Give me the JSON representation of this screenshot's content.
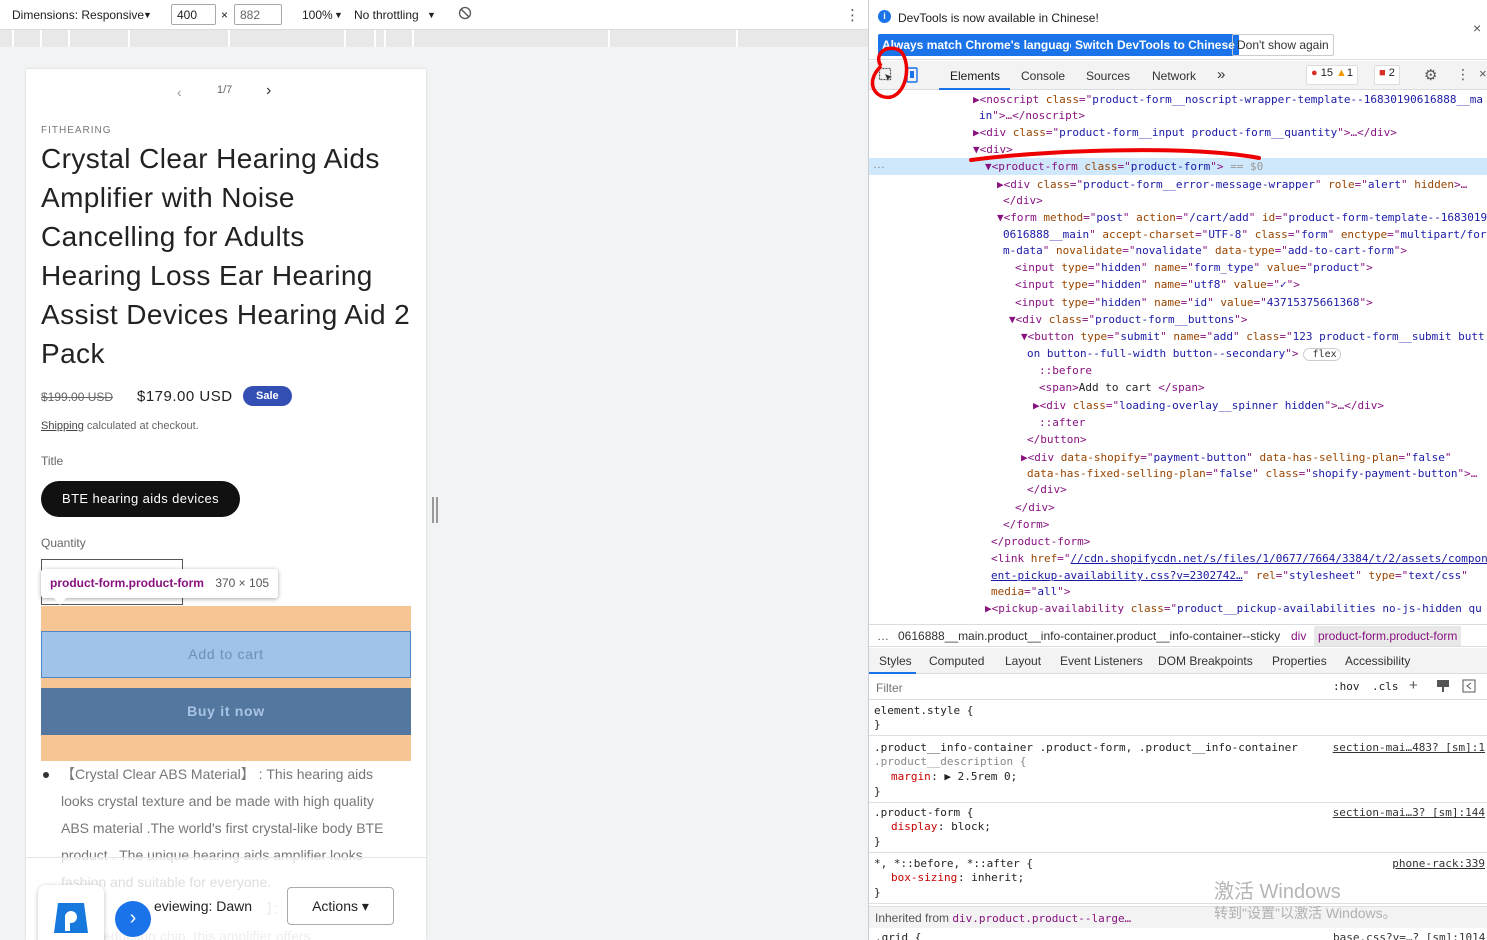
{
  "devbar": {
    "dimensions": "Dimensions: Responsive",
    "width": "400",
    "height": "882",
    "times": "×",
    "zoom": "100%",
    "throttling": "No throttling",
    "more": "⋮"
  },
  "product": {
    "vendor": "FITHEARING",
    "pager": "1/7",
    "title_lines": [
      "Crystal Clear Hearing Aids",
      "Amplifier with Noise",
      "Cancelling for Adults",
      "Hearing Loss Ear Hearing",
      "Assist Devices Hearing Aid 2",
      "Pack"
    ],
    "old_price": "$199.00 USD",
    "price": "$179.00 USD",
    "sale": "Sale",
    "shipping_link": "Shipping",
    "shipping_text": " calculated at checkout.",
    "title_label": "Title",
    "variant": "BTE hearing aids devices",
    "quantity_label": "Quantity",
    "tooltip_name": "product-form.product-form",
    "tooltip_size": "370 × 105",
    "add_to_cart": "Add to cart",
    "buy_now": "Buy it now",
    "desc_lines": [
      "【Crystal Clear ABS Material】 : This hearing aids",
      "looks crystal texture and be made with high quality",
      "ABS material .The world's first crystal-like body BTE",
      "product . The unique hearing aids amplifier looks",
      "fashion and suitable for everyone.",
      "】：Hearing",
      "noise reduction chip, this amplifier offers"
    ],
    "preview_text": "eviewing: Dawn",
    "actions": "Actions ▾"
  },
  "devtools": {
    "infobar": "DevTools is now available in Chinese!",
    "btn_match": "Always match Chrome's language",
    "btn_switch": "Switch DevTools to Chinese",
    "btn_dont": "Don't show again",
    "tabs": [
      "Elements",
      "Console",
      "Sources",
      "Network"
    ],
    "more_tabs": "»",
    "err_count": "15",
    "warn_count": "1",
    "issue_count": "2",
    "close": "×",
    "dom_lines": [
      [
        {
          "c": "tok-tag",
          "t": "▶<noscript "
        },
        {
          "c": "tok-attr",
          "t": "class"
        },
        {
          "c": "tok-tag",
          "t": "=\""
        },
        {
          "c": "tok-val",
          "t": "product-form__noscript-wrapper-template--16830190616888__ma"
        }
      ],
      [
        {
          "c": "tok-val",
          "t": "in"
        },
        {
          "c": "tok-tag",
          "t": "\">…</noscript>"
        }
      ],
      [
        {
          "c": "tok-tag",
          "t": "▶<div "
        },
        {
          "c": "tok-attr",
          "t": "class"
        },
        {
          "c": "tok-tag",
          "t": "=\""
        },
        {
          "c": "tok-val",
          "t": "product-form__input product-form__quantity"
        },
        {
          "c": "tok-tag",
          "t": "\">…</div>"
        }
      ],
      [
        {
          "c": "tok-tag",
          "t": "▼<div>"
        }
      ],
      [
        {
          "c": "tok-tag",
          "t": "▼<product-form "
        },
        {
          "c": "tok-attr",
          "t": "class"
        },
        {
          "c": "tok-tag",
          "t": "=\""
        },
        {
          "c": "tok-val",
          "t": "product-form"
        },
        {
          "c": "tok-tag",
          "t": "\">"
        },
        {
          "c": "tok-cm",
          "t": " == $0"
        }
      ],
      [
        {
          "c": "tok-tag",
          "t": "▶<div "
        },
        {
          "c": "tok-attr",
          "t": "class"
        },
        {
          "c": "tok-tag",
          "t": "=\""
        },
        {
          "c": "tok-val",
          "t": "product-form__error-message-wrapper"
        },
        {
          "c": "tok-tag",
          "t": "\" "
        },
        {
          "c": "tok-attr",
          "t": "role"
        },
        {
          "c": "tok-tag",
          "t": "=\""
        },
        {
          "c": "tok-val",
          "t": "alert"
        },
        {
          "c": "tok-tag",
          "t": "\" "
        },
        {
          "c": "tok-attr",
          "t": "hidden"
        },
        {
          "c": "tok-tag",
          "t": ">…"
        }
      ],
      [
        {
          "c": "tok-tag",
          "t": "</div>"
        }
      ],
      [
        {
          "c": "tok-tag",
          "t": "▼<form "
        },
        {
          "c": "tok-attr",
          "t": "method"
        },
        {
          "c": "tok-tag",
          "t": "=\""
        },
        {
          "c": "tok-val",
          "t": "post"
        },
        {
          "c": "tok-tag",
          "t": "\" "
        },
        {
          "c": "tok-attr",
          "t": "action"
        },
        {
          "c": "tok-tag",
          "t": "=\""
        },
        {
          "c": "tok-val",
          "t": "/cart/add"
        },
        {
          "c": "tok-tag",
          "t": "\" "
        },
        {
          "c": "tok-attr",
          "t": "id"
        },
        {
          "c": "tok-tag",
          "t": "=\""
        },
        {
          "c": "tok-val",
          "t": "product-form-template--1683019"
        }
      ],
      [
        {
          "c": "tok-val",
          "t": "0616888__main"
        },
        {
          "c": "tok-tag",
          "t": "\" "
        },
        {
          "c": "tok-attr",
          "t": "accept-charset"
        },
        {
          "c": "tok-tag",
          "t": "=\""
        },
        {
          "c": "tok-val",
          "t": "UTF-8"
        },
        {
          "c": "tok-tag",
          "t": "\" "
        },
        {
          "c": "tok-attr",
          "t": "class"
        },
        {
          "c": "tok-tag",
          "t": "=\""
        },
        {
          "c": "tok-val",
          "t": "form"
        },
        {
          "c": "tok-tag",
          "t": "\" "
        },
        {
          "c": "tok-attr",
          "t": "enctype"
        },
        {
          "c": "tok-tag",
          "t": "=\""
        },
        {
          "c": "tok-val",
          "t": "multipart/for"
        }
      ],
      [
        {
          "c": "tok-val",
          "t": "m-data"
        },
        {
          "c": "tok-tag",
          "t": "\" "
        },
        {
          "c": "tok-attr",
          "t": "novalidate"
        },
        {
          "c": "tok-tag",
          "t": "=\""
        },
        {
          "c": "tok-val",
          "t": "novalidate"
        },
        {
          "c": "tok-tag",
          "t": "\" "
        },
        {
          "c": "tok-attr",
          "t": "data-type"
        },
        {
          "c": "tok-tag",
          "t": "=\""
        },
        {
          "c": "tok-val",
          "t": "add-to-cart-form"
        },
        {
          "c": "tok-tag",
          "t": "\">"
        }
      ],
      [
        {
          "c": "tok-tag",
          "t": "<input "
        },
        {
          "c": "tok-attr",
          "t": "type"
        },
        {
          "c": "tok-tag",
          "t": "=\""
        },
        {
          "c": "tok-val",
          "t": "hidden"
        },
        {
          "c": "tok-tag",
          "t": "\" "
        },
        {
          "c": "tok-attr",
          "t": "name"
        },
        {
          "c": "tok-tag",
          "t": "=\""
        },
        {
          "c": "tok-val",
          "t": "form_type"
        },
        {
          "c": "tok-tag",
          "t": "\" "
        },
        {
          "c": "tok-attr",
          "t": "value"
        },
        {
          "c": "tok-tag",
          "t": "=\""
        },
        {
          "c": "tok-val",
          "t": "product"
        },
        {
          "c": "tok-tag",
          "t": "\">"
        }
      ],
      [
        {
          "c": "tok-tag",
          "t": "<input "
        },
        {
          "c": "tok-attr",
          "t": "type"
        },
        {
          "c": "tok-tag",
          "t": "=\""
        },
        {
          "c": "tok-val",
          "t": "hidden"
        },
        {
          "c": "tok-tag",
          "t": "\" "
        },
        {
          "c": "tok-attr",
          "t": "name"
        },
        {
          "c": "tok-tag",
          "t": "=\""
        },
        {
          "c": "tok-val",
          "t": "utf8"
        },
        {
          "c": "tok-tag",
          "t": "\" "
        },
        {
          "c": "tok-attr",
          "t": "value"
        },
        {
          "c": "tok-tag",
          "t": "=\""
        },
        {
          "c": "tok-val",
          "t": "✓"
        },
        {
          "c": "tok-tag",
          "t": "\">"
        }
      ],
      [
        {
          "c": "tok-tag",
          "t": "<input "
        },
        {
          "c": "tok-attr",
          "t": "type"
        },
        {
          "c": "tok-tag",
          "t": "=\""
        },
        {
          "c": "tok-val",
          "t": "hidden"
        },
        {
          "c": "tok-tag",
          "t": "\" "
        },
        {
          "c": "tok-attr",
          "t": "name"
        },
        {
          "c": "tok-tag",
          "t": "=\""
        },
        {
          "c": "tok-val",
          "t": "id"
        },
        {
          "c": "tok-tag",
          "t": "\" "
        },
        {
          "c": "tok-attr",
          "t": "value"
        },
        {
          "c": "tok-tag",
          "t": "=\""
        },
        {
          "c": "tok-val",
          "t": "43715375661368"
        },
        {
          "c": "tok-tag",
          "t": "\">"
        }
      ],
      [
        {
          "c": "tok-tag",
          "t": "▼<div "
        },
        {
          "c": "tok-attr",
          "t": "class"
        },
        {
          "c": "tok-tag",
          "t": "=\""
        },
        {
          "c": "tok-val",
          "t": "product-form__buttons"
        },
        {
          "c": "tok-tag",
          "t": "\">"
        }
      ],
      [
        {
          "c": "tok-tag",
          "t": "▼<button "
        },
        {
          "c": "tok-attr",
          "t": "type"
        },
        {
          "c": "tok-tag",
          "t": "=\""
        },
        {
          "c": "tok-val",
          "t": "submit"
        },
        {
          "c": "tok-tag",
          "t": "\" "
        },
        {
          "c": "tok-attr",
          "t": "name"
        },
        {
          "c": "tok-tag",
          "t": "=\""
        },
        {
          "c": "tok-val",
          "t": "add"
        },
        {
          "c": "tok-tag",
          "t": "\" "
        },
        {
          "c": "tok-attr",
          "t": "class"
        },
        {
          "c": "tok-tag",
          "t": "=\""
        },
        {
          "c": "tok-val",
          "t": "123 product-form__submit butt"
        }
      ],
      [
        {
          "c": "tok-val",
          "t": "on button--full-width button--secondary"
        },
        {
          "c": "tok-tag",
          "t": "\">"
        },
        {
          "c": "tok-cm",
          "t": " flex "
        }
      ],
      [
        {
          "c": "tok-tag",
          "t": "::before"
        }
      ],
      [
        {
          "c": "tok-tag",
          "t": "<span>"
        },
        {
          "c": "tok-txt",
          "t": "Add to cart "
        },
        {
          "c": "tok-tag",
          "t": "</span>"
        }
      ],
      [
        {
          "c": "tok-tag",
          "t": "▶<div "
        },
        {
          "c": "tok-attr",
          "t": "class"
        },
        {
          "c": "tok-tag",
          "t": "=\""
        },
        {
          "c": "tok-val",
          "t": "loading-overlay__spinner hidden"
        },
        {
          "c": "tok-tag",
          "t": "\">…</div>"
        }
      ],
      [
        {
          "c": "tok-tag",
          "t": "::after"
        }
      ],
      [
        {
          "c": "tok-tag",
          "t": "</button>"
        }
      ],
      [
        {
          "c": "tok-tag",
          "t": "▶<div "
        },
        {
          "c": "tok-attr",
          "t": "data-shopify"
        },
        {
          "c": "tok-tag",
          "t": "=\""
        },
        {
          "c": "tok-val",
          "t": "payment-button"
        },
        {
          "c": "tok-tag",
          "t": "\" "
        },
        {
          "c": "tok-attr",
          "t": "data-has-selling-plan"
        },
        {
          "c": "tok-tag",
          "t": "=\""
        },
        {
          "c": "tok-val",
          "t": "false"
        },
        {
          "c": "tok-tag",
          "t": "\""
        }
      ],
      [
        {
          "c": "tok-attr",
          "t": "data-has-fixed-selling-plan"
        },
        {
          "c": "tok-tag",
          "t": "=\""
        },
        {
          "c": "tok-val",
          "t": "false"
        },
        {
          "c": "tok-tag",
          "t": "\" "
        },
        {
          "c": "tok-attr",
          "t": "class"
        },
        {
          "c": "tok-tag",
          "t": "=\""
        },
        {
          "c": "tok-val",
          "t": "shopify-payment-button"
        },
        {
          "c": "tok-tag",
          "t": "\">…"
        }
      ],
      [
        {
          "c": "tok-tag",
          "t": "</div>"
        }
      ],
      [
        {
          "c": "tok-tag",
          "t": "</div>"
        }
      ],
      [
        {
          "c": "tok-tag",
          "t": "</form>"
        }
      ],
      [
        {
          "c": "tok-tag",
          "t": "</product-form>"
        }
      ],
      [
        {
          "c": "tok-tag",
          "t": "<link "
        },
        {
          "c": "tok-attr",
          "t": "href"
        },
        {
          "c": "tok-tag",
          "t": "=\""
        },
        {
          "c": "tok-val",
          "t": "//cdn.shopifycdn.net/s/files/1/0677/7664/3384/t/2/assets/compon"
        }
      ],
      [
        {
          "c": "tok-val",
          "t": "ent-pickup-availability.css?v=2302742…"
        },
        {
          "c": "tok-tag",
          "t": "\" "
        },
        {
          "c": "tok-attr",
          "t": "rel"
        },
        {
          "c": "tok-tag",
          "t": "=\""
        },
        {
          "c": "tok-val",
          "t": "stylesheet"
        },
        {
          "c": "tok-tag",
          "t": "\" "
        },
        {
          "c": "tok-attr",
          "t": "type"
        },
        {
          "c": "tok-tag",
          "t": "=\""
        },
        {
          "c": "tok-val",
          "t": "text/css"
        },
        {
          "c": "tok-tag",
          "t": "\""
        }
      ],
      [
        {
          "c": "tok-attr",
          "t": "media"
        },
        {
          "c": "tok-tag",
          "t": "=\""
        },
        {
          "c": "tok-val",
          "t": "all"
        },
        {
          "c": "tok-tag",
          "t": "\">"
        }
      ],
      [
        {
          "c": "tok-tag",
          "t": "▶<pickup-availability "
        },
        {
          "c": "tok-attr",
          "t": "class"
        },
        {
          "c": "tok-tag",
          "t": "=\""
        },
        {
          "c": "tok-val",
          "t": "product__pickup-availabilities no-js-hidden qu"
        }
      ]
    ],
    "breadcrumb": [
      "…",
      "0616888__main.product__info-container.product__info-container--sticky",
      "div",
      "product-form.product-form"
    ],
    "subtabs": [
      "Styles",
      "Computed",
      "Layout",
      "Event Listeners",
      "DOM Breakpoints",
      "Properties",
      "Accessibility"
    ],
    "filter_placeholder": "Filter",
    "hov": ":hov",
    "cls": ".cls",
    "css_rules": [
      {
        "sel": "element.style {",
        "src": "",
        "decls": [],
        "close": "}"
      },
      {
        "sel": ".product__info-container .product-form, .product__info-container",
        "sel2": ".product__description {",
        "src": "section-mai…483? [sm]:1",
        "decls": [
          [
            "margin",
            ": ▶ 2.5rem 0;"
          ]
        ],
        "close": "}"
      },
      {
        "sel": ".product-form {",
        "src": "section-mai…3? [sm]:144",
        "decls": [
          [
            "display",
            ": block;"
          ]
        ],
        "close": "}"
      },
      {
        "sel": "*, *::before, *::after {",
        "src": "phone-rack:339",
        "decls": [
          [
            "box-sizing",
            ": inherit;"
          ]
        ],
        "close": "}"
      }
    ],
    "inherited_label": "Inherited from ",
    "inherited_from": "div.product.product--large…",
    "last_rule": ".grid {",
    "last_src": "base.css?v=…? [sm]:1014",
    "watermark_1": "激活 Windows",
    "watermark_2": "转到\"设置\"以激活 Windows。"
  }
}
